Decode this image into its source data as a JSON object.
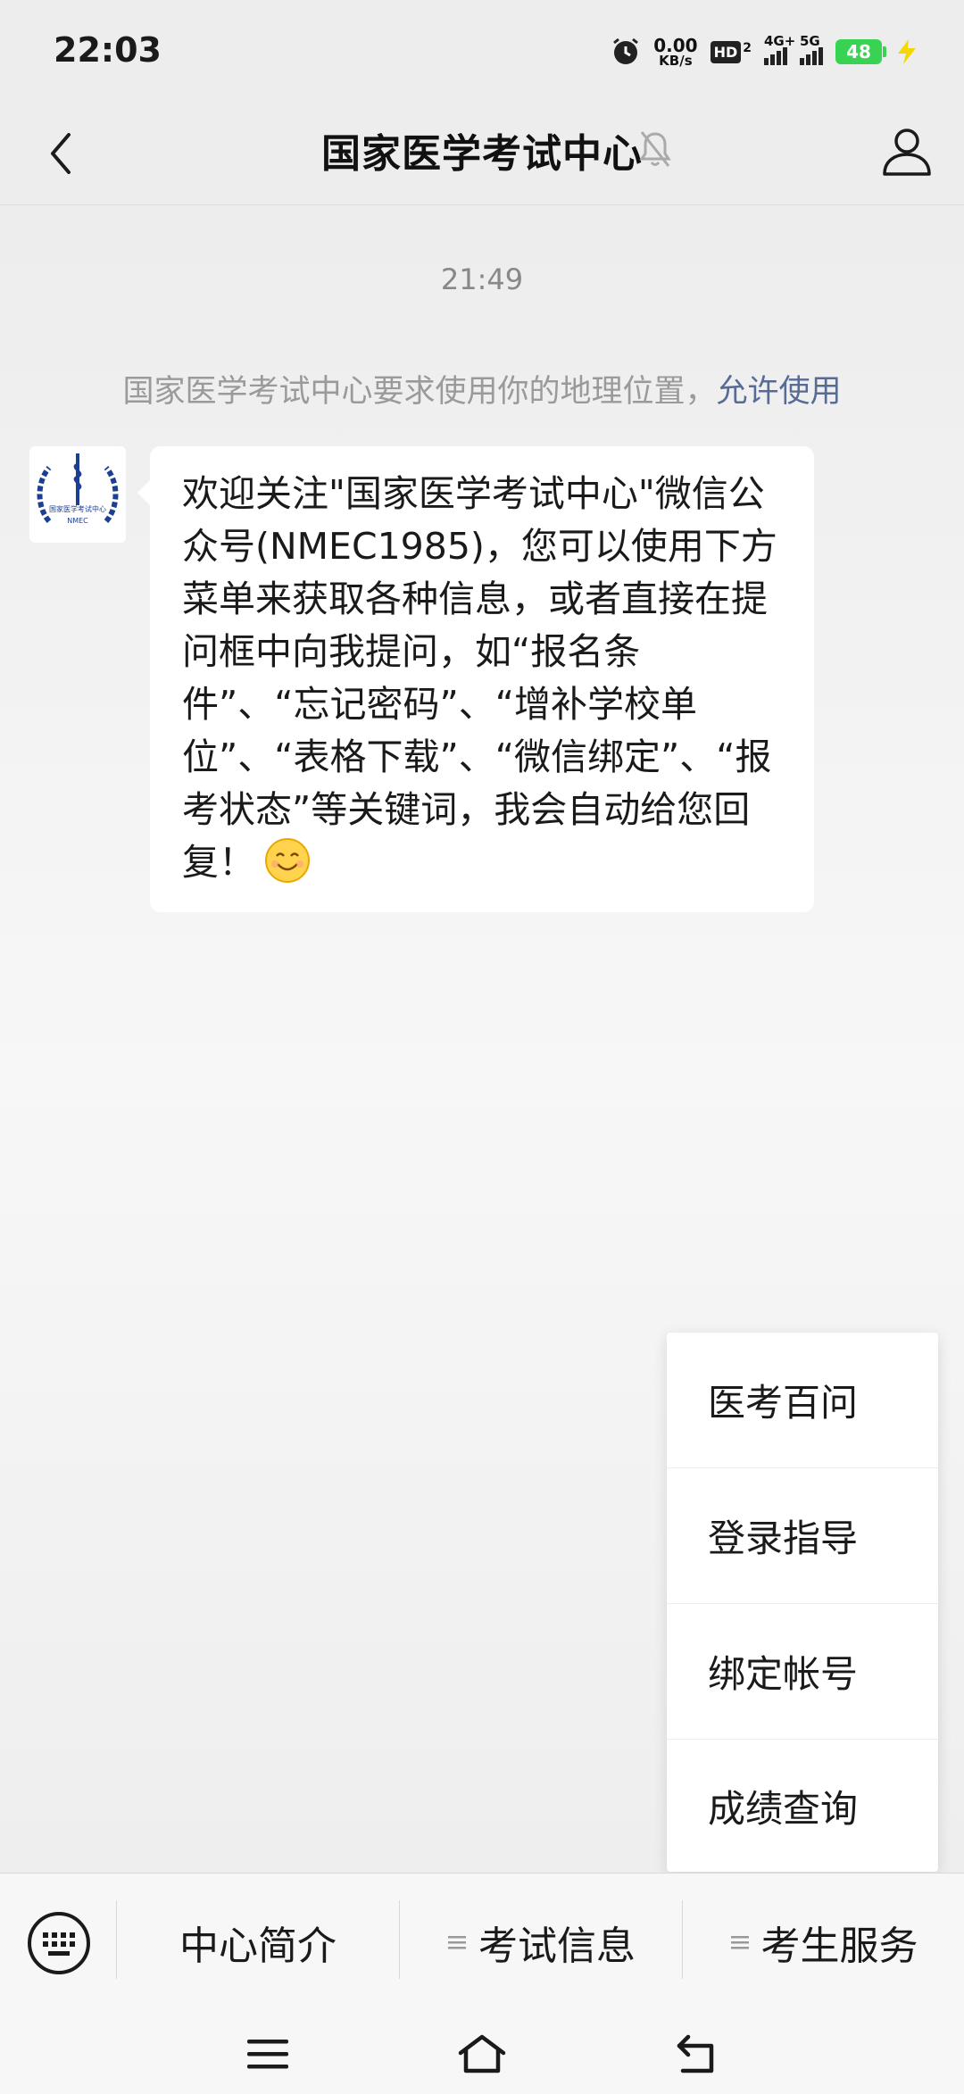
{
  "status": {
    "time": "22:03",
    "net_speed_value": "0.00",
    "net_speed_unit": "KB/s",
    "hd_label": "HD",
    "hd_sub": "2",
    "signal1_label": "4G+",
    "signal2_label": "5G",
    "battery": "48"
  },
  "header": {
    "title": "国家医学考试中心",
    "back_icon": "chevron-left-icon",
    "mute_icon": "bell-off-icon",
    "profile_icon": "person-icon"
  },
  "chat": {
    "timestamp": "21:49",
    "location_notice": "国家医学考试中心要求使用你的地理位置，",
    "location_allow": "允许使用",
    "message_text": "欢迎关注\"国家医学考试中心\"微信公众号(NMEC1985)，您可以使用下方菜单来获取各种信息，或者直接在提问框中向我提问，如“报名条件”、“忘记密码”、“增补学校单位”、“表格下载”、“微信绑定”、“报考状态”等关键词，我会自动给您回复！",
    "avatar_logo_text": "国家医学考试中心 NMEC 1985"
  },
  "submenu": {
    "items": [
      "医考百问",
      "登录指导",
      "绑定帐号",
      "成绩查询"
    ]
  },
  "menu_bar": {
    "keyboard_icon": "keyboard-icon",
    "tabs": [
      {
        "label": "中心简介",
        "has_sub": false
      },
      {
        "label": "考试信息",
        "has_sub": true
      },
      {
        "label": "考生服务",
        "has_sub": true
      }
    ]
  },
  "nav": {
    "menu_icon": "hamburger-icon",
    "home_icon": "home-icon",
    "back_icon": "back-arrow-icon"
  },
  "colors": {
    "link": "#576b95",
    "battery": "#39d353",
    "background": "#ededed"
  }
}
